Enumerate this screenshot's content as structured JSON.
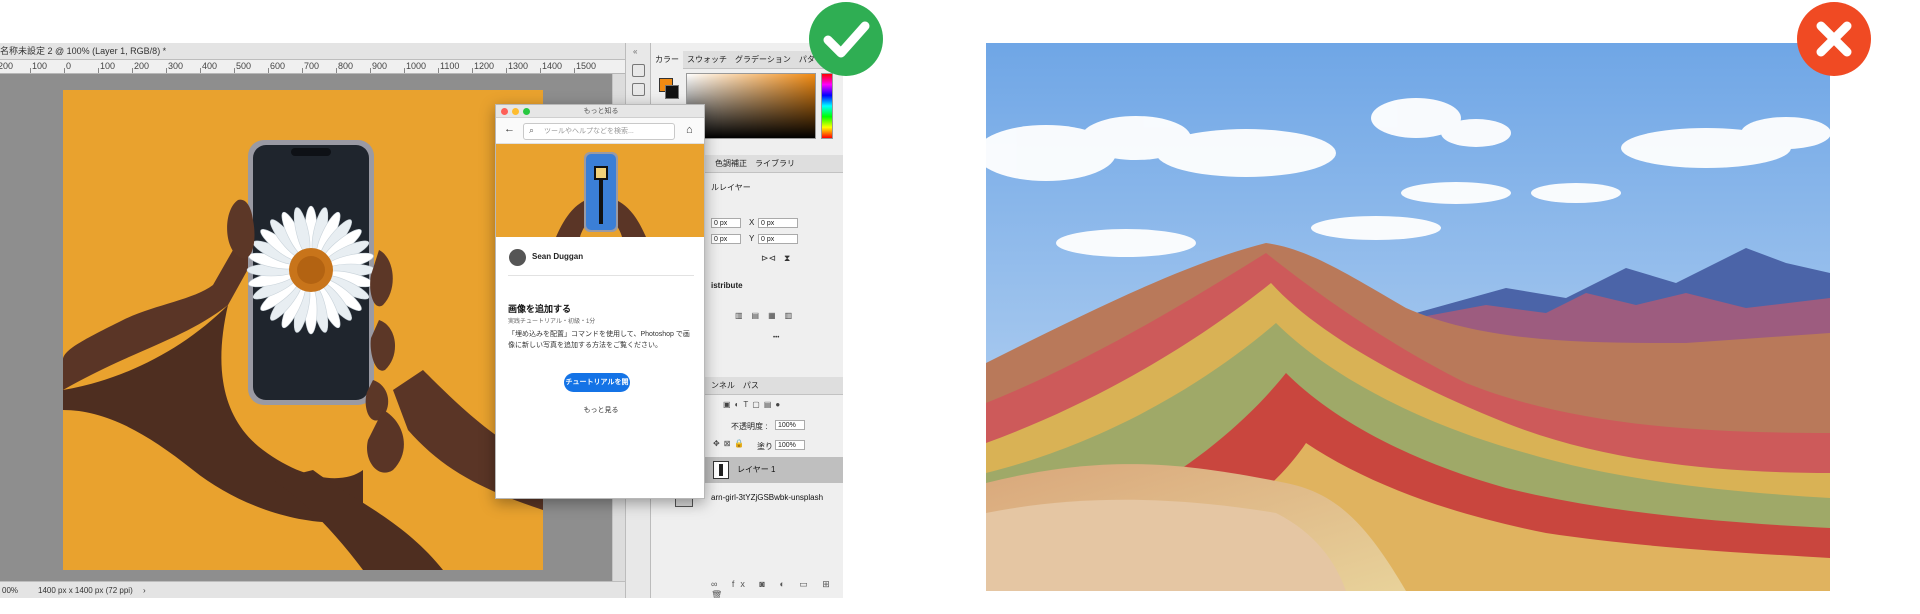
{
  "left_panel": {
    "doc_tab": "名称未設定 2 @ 100% (Layer 1, RGB/8) *",
    "ruler_ticks": [
      "200",
      "100",
      "0",
      "100",
      "200",
      "300",
      "400",
      "500",
      "600",
      "700",
      "800",
      "900",
      "1000",
      "1100",
      "1200",
      "1300",
      "1400",
      "1500"
    ],
    "status_zoom": "00%",
    "status_doc": "1400 px x 1400 px (72 ppi)",
    "status_arrow": "›",
    "color_tabs": [
      "カラー",
      "スウォッチ",
      "グラデーション",
      "パターン"
    ],
    "adjust_tabs": [
      "色調補正",
      "ライブラリ"
    ],
    "layer_panel_title": "ルレイヤー",
    "x_label": "X",
    "y_label": "Y",
    "w_value": "0 px",
    "x_value": "0 px",
    "h_value": "0 px",
    "y_value": "0 px",
    "distribute_label": "istribute",
    "more_dots": "•••",
    "layers_tabs": [
      "ンネル",
      "パス"
    ],
    "opacity_label": "不透明度 :",
    "opacity_value": "100%",
    "fill_label": "塗り :",
    "fill_value": "100%",
    "layer1_name": "レイヤー 1",
    "layer2_name": "arn-girl-3tYZjGSBwbk-unsplash",
    "popup": {
      "title": "もっと知る",
      "search_placeholder": "ツールやヘルプなどを検索...",
      "author": "Sean Duggan",
      "heading": "画像を追加する",
      "meta": "実践チュートリアル・初級・1分",
      "description": "「埋め込みを配置」コマンドを使用して、Photoshop で画像に新しい写真を追加する方法をご覧ください。",
      "cta": "チュートリアルを開始",
      "more": "もっと見る"
    }
  },
  "badges": {
    "good_color": "#2fae53",
    "bad_color": "#f04a23"
  }
}
